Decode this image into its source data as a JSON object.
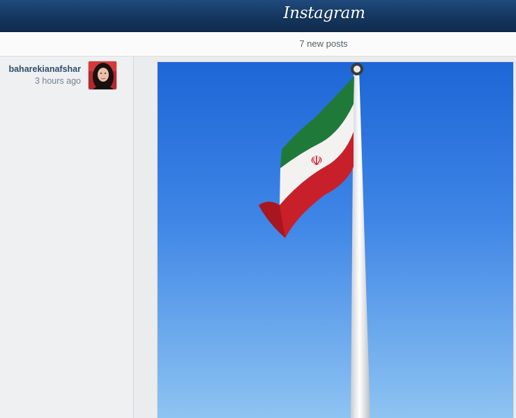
{
  "header": {
    "logo_text": "Instagram"
  },
  "feed": {
    "new_posts_label": "7 new posts"
  },
  "post": {
    "username": "baharekianafshar",
    "timestamp": "3 hours ago"
  }
}
